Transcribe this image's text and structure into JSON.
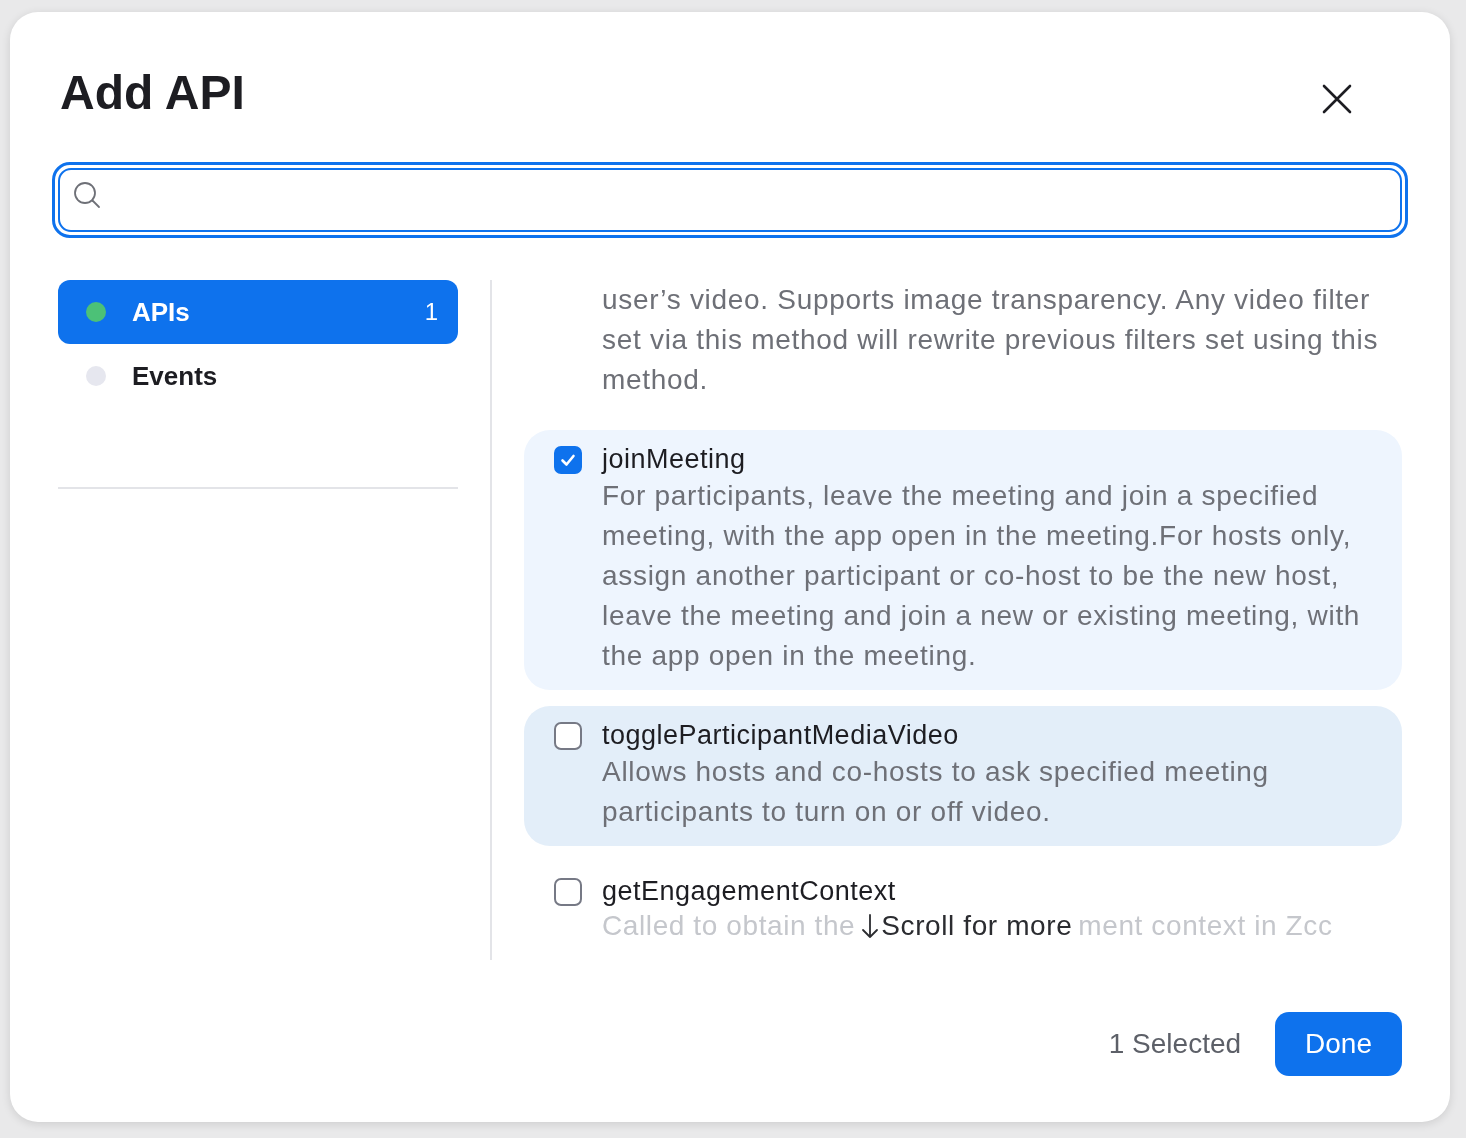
{
  "dialog": {
    "title": "Add API"
  },
  "categories": [
    {
      "label": "APIs",
      "count": "1",
      "selected": true,
      "color": "#4cc177"
    },
    {
      "label": "Events",
      "selected": false,
      "color": "#e6e7ef"
    }
  ],
  "items": [
    {
      "kind": "partial",
      "description": "user’s video. Supports image transparency. Any video filter set via this method will rewrite previous filters set using this method."
    },
    {
      "kind": "option",
      "name": "joinMeeting",
      "checked": true,
      "hovered": false,
      "description": "For participants, leave the meeting and join a specified meeting, with the app open in the meeting.For hosts only, assign another participant or co-host to be the new host, leave the meeting and join a new or existing meeting, with the app open in the meeting."
    },
    {
      "kind": "option",
      "name": "toggleParticipantMediaVideo",
      "checked": false,
      "hovered": true,
      "description": "Allows hosts and co-hosts to ask specified meeting participants to turn on or off video."
    },
    {
      "kind": "cut",
      "name": "getEngagementContext",
      "checked": false,
      "hovered": false,
      "description_parts": [
        "Called to obtain the",
        "ment context in Zcc"
      ]
    }
  ],
  "scroll_hint": "Scroll for more",
  "footer": {
    "selected_count": "1 Selected",
    "done": "Done"
  }
}
